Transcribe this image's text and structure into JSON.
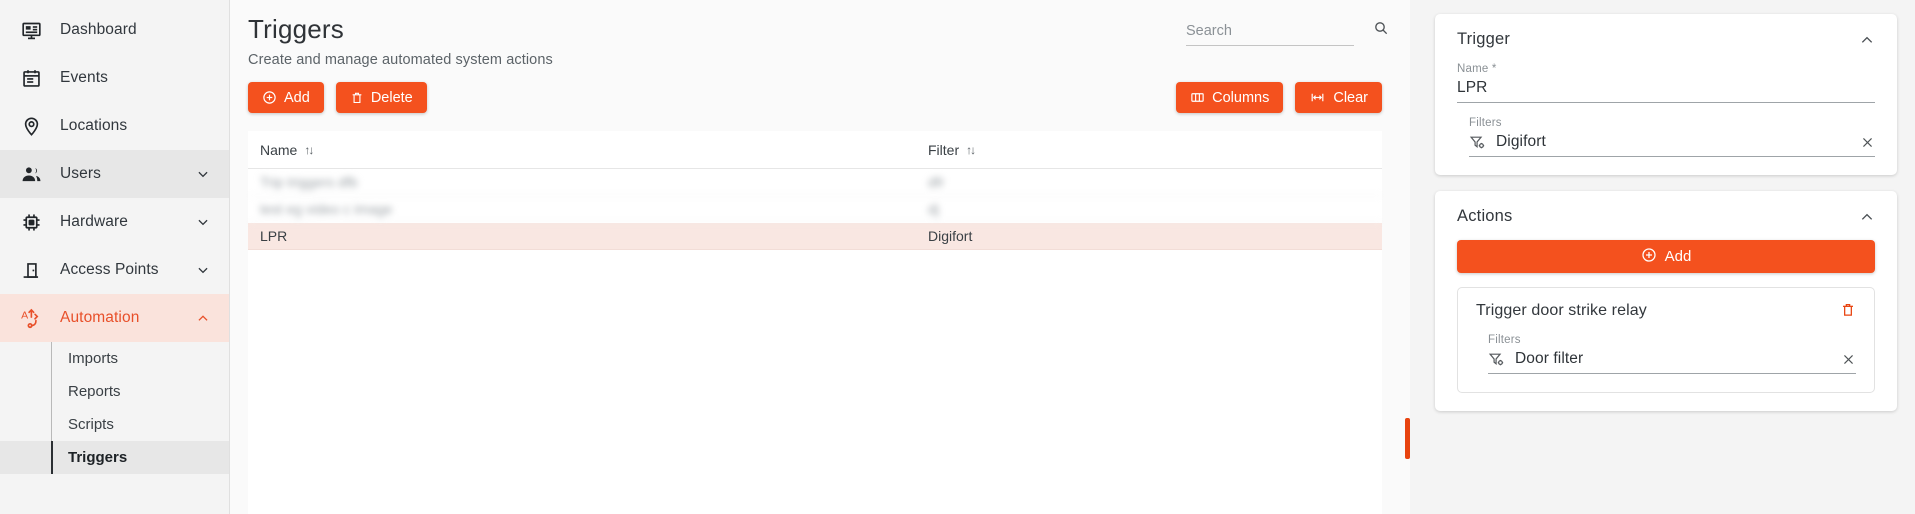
{
  "sidebar": {
    "items": [
      {
        "label": "Dashboard",
        "icon": "dashboard-icon",
        "state": "default",
        "expandable": false
      },
      {
        "label": "Events",
        "icon": "calendar-icon",
        "state": "default",
        "expandable": false
      },
      {
        "label": "Locations",
        "icon": "map-pin-icon",
        "state": "default",
        "expandable": false
      },
      {
        "label": "Users",
        "icon": "users-icon",
        "state": "hovered",
        "expandable": true,
        "chevron": "chevron-down-icon"
      },
      {
        "label": "Hardware",
        "icon": "chip-icon",
        "state": "default",
        "expandable": true,
        "chevron": "chevron-down-icon"
      },
      {
        "label": "Access Points",
        "icon": "door-icon",
        "state": "default",
        "expandable": true,
        "chevron": "chevron-down-icon"
      },
      {
        "label": "Automation",
        "icon": "automation-icon",
        "state": "active",
        "expandable": true,
        "chevron": "chevron-up-icon"
      }
    ],
    "subitems": [
      {
        "label": "Imports",
        "selected": false
      },
      {
        "label": "Reports",
        "selected": false
      },
      {
        "label": "Scripts",
        "selected": false
      },
      {
        "label": "Triggers",
        "selected": true
      }
    ]
  },
  "main": {
    "title": "Triggers",
    "subtitle": "Create and manage automated system actions",
    "buttons": {
      "add": "Add",
      "delete": "Delete",
      "columns": "Columns",
      "clear": "Clear"
    },
    "search": {
      "value": "",
      "placeholder": "Search",
      "icon": "search-icon"
    },
    "table": {
      "columns": [
        {
          "key": "name",
          "label": "Name",
          "sort": "unsorted"
        },
        {
          "key": "filter",
          "label": "Filter",
          "sort": "unsorted"
        }
      ],
      "rows": [
        {
          "name": "",
          "filter": "",
          "redacted": true,
          "selected": false
        },
        {
          "name": "",
          "filter": "",
          "redacted": true,
          "selected": false
        },
        {
          "name": "LPR",
          "filter": "Digifort",
          "redacted": false,
          "selected": true
        }
      ]
    }
  },
  "right_panel": {
    "trigger_card": {
      "title": "Trigger",
      "collapse_icon": "chevron-up-icon",
      "name_field": {
        "label": "Name *",
        "value": "LPR"
      },
      "filters_field": {
        "label": "Filters",
        "value": "Digifort",
        "icon": "filter-settings-icon",
        "clear_icon": "close-icon"
      }
    },
    "actions_card": {
      "title": "Actions",
      "collapse_icon": "chevron-up-icon",
      "add_label": "Add",
      "items": [
        {
          "title": "Trigger door strike relay",
          "delete_icon": "trash-icon",
          "filters_field": {
            "label": "Filters",
            "value": "Door filter",
            "icon": "filter-settings-icon",
            "clear_icon": "close-icon"
          }
        }
      ]
    }
  },
  "colors": {
    "accent": "#f4511e",
    "accent_dark": "#e8430f",
    "active_nav_bg": "#fae3dc",
    "selected_row_bg": "#f9e7e2",
    "sidebar_bg": "#f4f4f4",
    "main_bg": "#fafafa"
  }
}
